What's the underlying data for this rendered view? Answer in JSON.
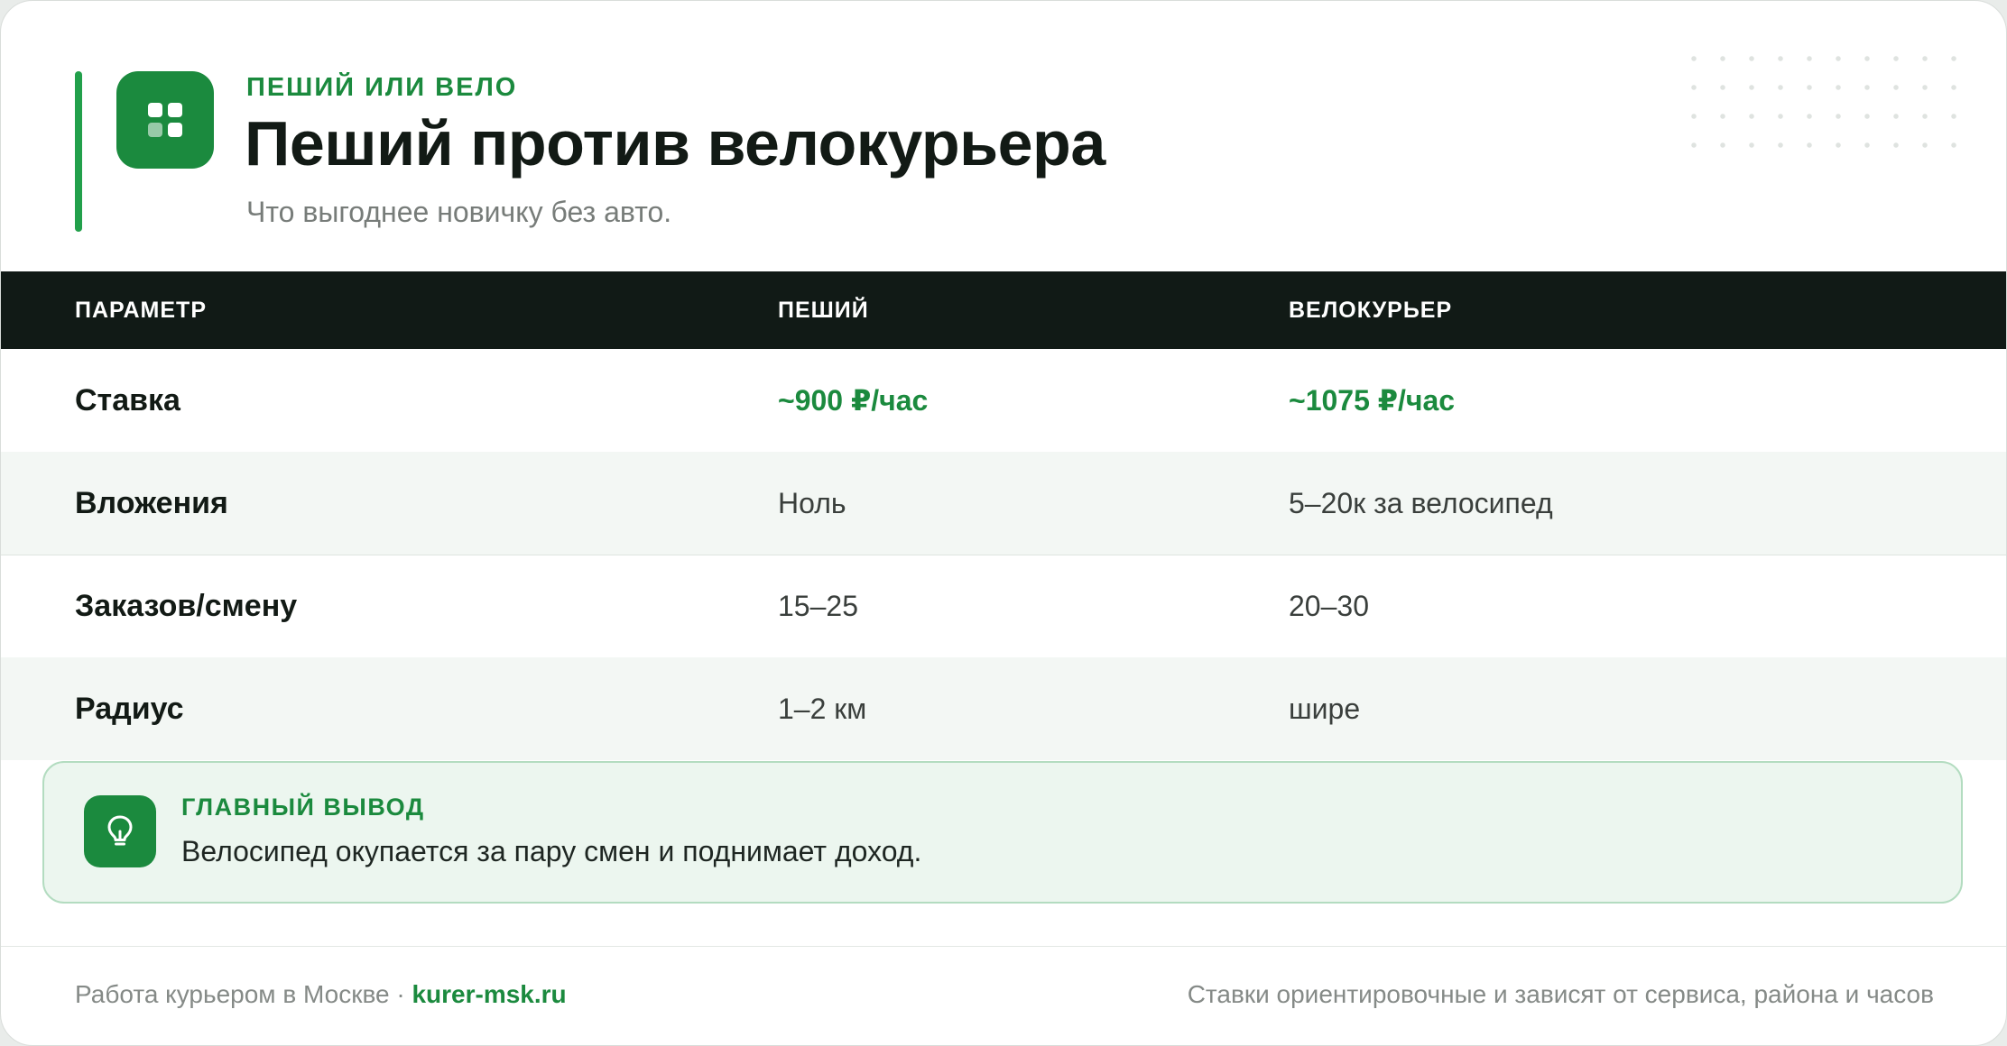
{
  "header": {
    "eyebrow": "ПЕШИЙ ИЛИ ВЕЛО",
    "title": "Пеший против велокурьера",
    "subtitle": "Что выгоднее новичку без авто.",
    "logo_icon": "grid-icon",
    "accent_color": "#1b8a3e"
  },
  "table": {
    "headers": [
      "ПАРАМЕТР",
      "ПЕШИЙ",
      "ВЕЛОКУРЬЕР"
    ],
    "rows": [
      {
        "param": "Ставка",
        "walk": "~900 ₽/час",
        "bike": "~1075 ₽/час",
        "highlight": true
      },
      {
        "param": "Вложения",
        "walk": "Ноль",
        "bike": "5–20к за велосипед"
      },
      {
        "param": "Заказов/смену",
        "walk": "15–25",
        "bike": "20–30"
      },
      {
        "param": "Радиус",
        "walk": "1–2 км",
        "bike": "шире"
      }
    ]
  },
  "conclusion": {
    "icon": "lightbulb-icon",
    "label": "ГЛАВНЫЙ ВЫВОД",
    "text": "Велосипед окупается за пару смен и поднимает доход."
  },
  "footer": {
    "left_text": "Работа курьером в Москве · ",
    "site": "kurer-msk.ru",
    "right_text": "Ставки ориентировочные и зависят от сервиса, района и часов"
  }
}
